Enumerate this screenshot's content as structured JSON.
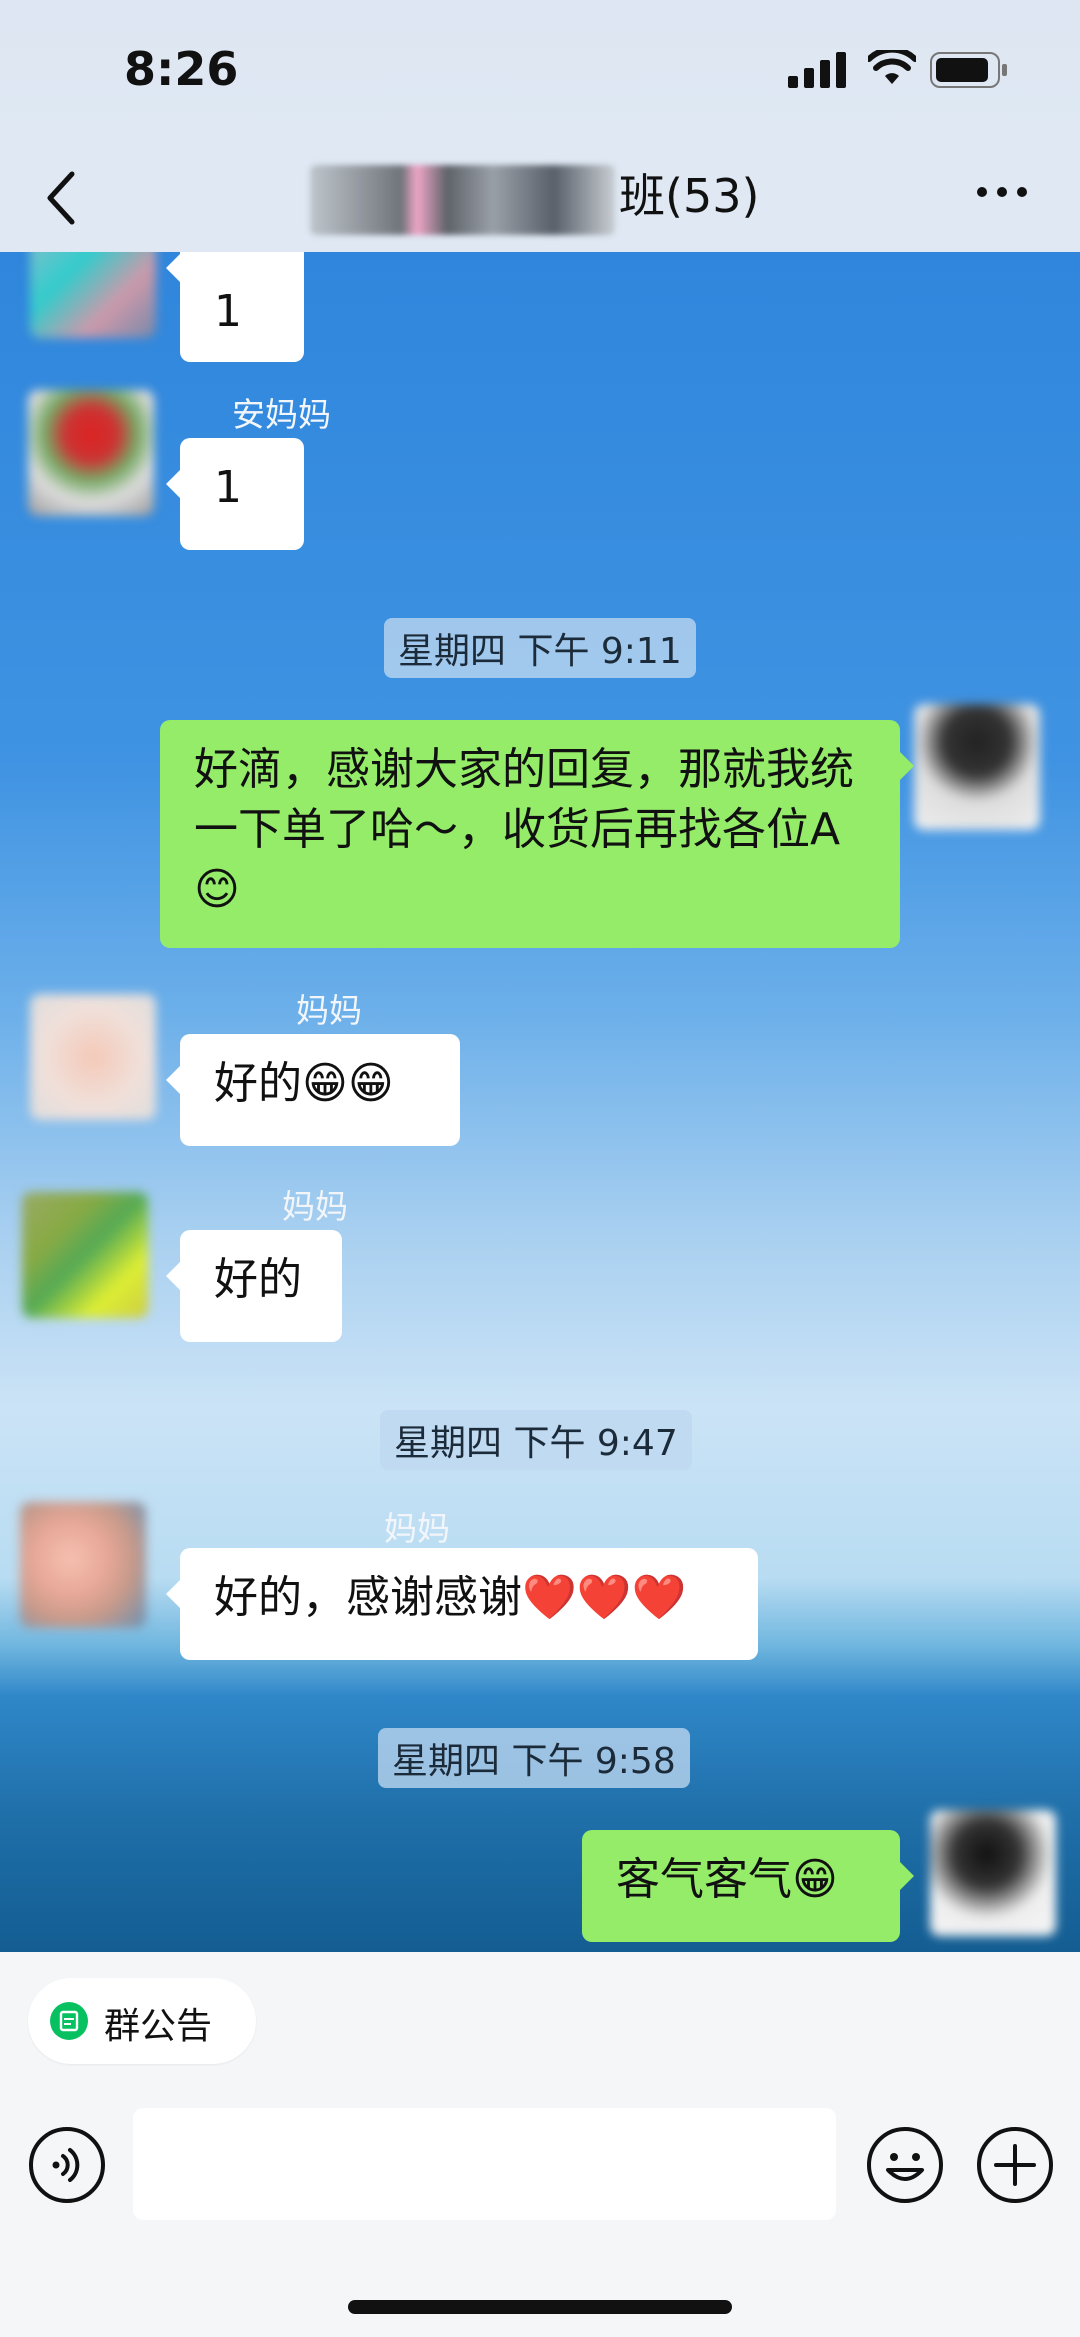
{
  "status": {
    "time": "8:26"
  },
  "header": {
    "title_suffix": "班(53)"
  },
  "messages": [
    {
      "sender": "",
      "text": "1"
    },
    {
      "sender": "安妈妈",
      "text": "1"
    },
    {
      "timestamp": "星期四 下午 9:11"
    },
    {
      "mine": true,
      "text": "好滴，感谢大家的回复，那就我统一下单了哈～，收货后再找各位A😊"
    },
    {
      "sender": "妈妈",
      "text": "好的😁😁"
    },
    {
      "sender": "妈妈",
      "text": "好的"
    },
    {
      "timestamp": "星期四 下午 9:47"
    },
    {
      "sender": "妈妈",
      "text": "好的，感谢感谢❤️❤️❤️"
    },
    {
      "timestamp": "星期四 下午 9:58"
    },
    {
      "mine": true,
      "text": "客气客气😁"
    }
  ],
  "bottom": {
    "notice_label": "群公告"
  },
  "icons": {
    "back": "chevron-left-icon",
    "more": "more-dots-icon",
    "voice": "voice-icon",
    "emoji": "emoji-icon",
    "plus": "plus-icon",
    "notice": "announcement-icon"
  },
  "colors": {
    "my_bubble": "#95ec69",
    "other_bubble": "#ffffff",
    "notice_icon": "#07c160"
  }
}
